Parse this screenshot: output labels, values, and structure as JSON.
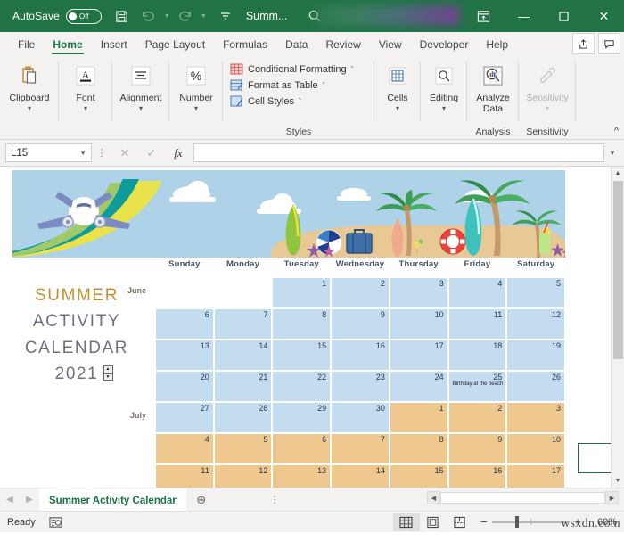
{
  "titlebar": {
    "autosave_label": "AutoSave",
    "autosave_state": "Off",
    "save_icon": "save-icon",
    "undo_icon": "undo-icon",
    "redo_icon": "redo-icon",
    "customize_icon": "customize-quick-access-icon",
    "document_title": "Summ...",
    "search_icon": "search-icon",
    "ribbon_display_icon": "ribbon-display-options-icon",
    "minimize_label": "—",
    "maximize_label": "☐",
    "close_label": "✕",
    "accent_color": "#217346"
  },
  "ribbon_tabs": [
    {
      "label": "File",
      "active": false
    },
    {
      "label": "Home",
      "active": true
    },
    {
      "label": "Insert",
      "active": false
    },
    {
      "label": "Page Layout",
      "active": false
    },
    {
      "label": "Formulas",
      "active": false
    },
    {
      "label": "Data",
      "active": false
    },
    {
      "label": "Review",
      "active": false
    },
    {
      "label": "View",
      "active": false
    },
    {
      "label": "Developer",
      "active": false
    },
    {
      "label": "Help",
      "active": false
    }
  ],
  "ribbon_right": {
    "share_icon": "share-icon",
    "comments_icon": "comments-icon"
  },
  "ribbon_groups": [
    {
      "label": "Clipboard",
      "icon": "clipboard-icon",
      "has_chevron": true,
      "disabled": false
    },
    {
      "label": "Font",
      "icon": "font-icon",
      "has_chevron": true,
      "disabled": false
    },
    {
      "label": "Alignment",
      "icon": "alignment-icon",
      "has_chevron": true,
      "disabled": false
    },
    {
      "label": "Number",
      "icon": "percent-icon",
      "has_chevron": true,
      "disabled": false
    }
  ],
  "styles_group": {
    "title": "Styles",
    "items": [
      {
        "label": "Conditional Formatting",
        "icon": "conditional-formatting-icon",
        "chevron": "ˇ"
      },
      {
        "label": "Format as Table",
        "icon": "format-as-table-icon",
        "chevron": "ˇ"
      },
      {
        "label": "Cell Styles",
        "icon": "cell-styles-icon",
        "chevron": "ˇ"
      }
    ]
  },
  "ribbon_groups_right": [
    {
      "label": "Cells",
      "icon": "cells-icon",
      "has_chevron": true,
      "disabled": false,
      "group_title": ""
    },
    {
      "label": "Editing",
      "icon": "editing-icon",
      "has_chevron": true,
      "disabled": false,
      "group_title": ""
    },
    {
      "label": "Analyze Data",
      "icon": "analyze-data-icon",
      "has_chevron": false,
      "disabled": false,
      "group_title": "Analysis"
    },
    {
      "label": "Sensitivity",
      "icon": "sensitivity-icon",
      "has_chevron": true,
      "disabled": true,
      "group_title": "Sensitivity"
    }
  ],
  "collapse_ribbon_icon": "chevron-up-icon",
  "formula_bar": {
    "name_box_value": "L15",
    "cancel_icon": "cancel-icon",
    "enter_icon": "enter-icon",
    "function_icon": "fx",
    "formula_value": "",
    "expand_icon": "chevron-down-icon"
  },
  "worksheet": {
    "title_lines": [
      {
        "text": "SUMMER",
        "color": "gold"
      },
      {
        "text": "ACTIVITY",
        "color": "gray"
      },
      {
        "text": "CALENDAR",
        "color": "gray"
      },
      {
        "text": "2021",
        "color": "gray"
      }
    ],
    "year_spinner": {
      "up": "▲",
      "down": "▼"
    },
    "banner_alt": "summer-beach-banner",
    "day_headers": [
      "Sunday",
      "Monday",
      "Tuesday",
      "Wednesday",
      "Thursday",
      "Friday",
      "Saturday"
    ],
    "month_labels": [
      {
        "name": "June",
        "row": 0
      },
      {
        "name": "July",
        "row": 4
      }
    ],
    "colors": {
      "june_fill": "#c3dcf0",
      "july_fill": "#eec88e",
      "sky": "#aed2e8",
      "sand": "#e8c995",
      "title_gold": "#c3922e",
      "title_gray": "#6b7280"
    },
    "weeks": [
      {
        "month": "june",
        "days": [
          {
            "num": "",
            "empty": true
          },
          {
            "num": "",
            "empty": true
          },
          {
            "num": "1"
          },
          {
            "num": "2"
          },
          {
            "num": "3"
          },
          {
            "num": "4"
          },
          {
            "num": "5"
          }
        ]
      },
      {
        "month": "june",
        "days": [
          {
            "num": "6"
          },
          {
            "num": "7"
          },
          {
            "num": "8"
          },
          {
            "num": "9"
          },
          {
            "num": "10"
          },
          {
            "num": "11"
          },
          {
            "num": "12"
          }
        ]
      },
      {
        "month": "june",
        "days": [
          {
            "num": "13"
          },
          {
            "num": "14"
          },
          {
            "num": "15"
          },
          {
            "num": "16"
          },
          {
            "num": "17"
          },
          {
            "num": "18"
          },
          {
            "num": "19"
          }
        ]
      },
      {
        "month": "june",
        "days": [
          {
            "num": "20"
          },
          {
            "num": "21"
          },
          {
            "num": "22"
          },
          {
            "num": "23"
          },
          {
            "num": "24"
          },
          {
            "num": "25",
            "event": "Birthday at the beach"
          },
          {
            "num": "26"
          }
        ]
      },
      {
        "month": "june",
        "days": [
          {
            "num": "27"
          },
          {
            "num": "28"
          },
          {
            "num": "29"
          },
          {
            "num": "30"
          },
          {
            "num": "1",
            "july": true
          },
          {
            "num": "2",
            "july": true
          },
          {
            "num": "3",
            "july": true
          }
        ]
      },
      {
        "month": "july",
        "days": [
          {
            "num": "4"
          },
          {
            "num": "5"
          },
          {
            "num": "6"
          },
          {
            "num": "7"
          },
          {
            "num": "8"
          },
          {
            "num": "9"
          },
          {
            "num": "10"
          }
        ]
      },
      {
        "month": "july",
        "days": [
          {
            "num": "11"
          },
          {
            "num": "12"
          },
          {
            "num": "13"
          },
          {
            "num": "14"
          },
          {
            "num": "15"
          },
          {
            "num": "16"
          },
          {
            "num": "17"
          }
        ]
      }
    ]
  },
  "sheet_tabs": {
    "prev_icon": "chevron-left-icon",
    "next_icon": "chevron-right-icon",
    "tabs": [
      {
        "label": "Summer Activity Calendar",
        "active": true
      }
    ],
    "add_sheet_icon": "plus-circle-icon",
    "overflow_icon": "vertical-dots-icon"
  },
  "status_bar": {
    "status_text": "Ready",
    "accessibility_icon": "accessibility-checker-icon",
    "views": [
      {
        "name": "normal-view",
        "icon": "grid-icon",
        "active": true
      },
      {
        "name": "page-layout-view",
        "icon": "page-layout-icon",
        "active": false
      },
      {
        "name": "page-break-view",
        "icon": "page-break-icon",
        "active": false
      }
    ],
    "zoom_out": "−",
    "zoom_in": "+",
    "zoom_level": "60%",
    "watermark": "wsxdn.com"
  }
}
